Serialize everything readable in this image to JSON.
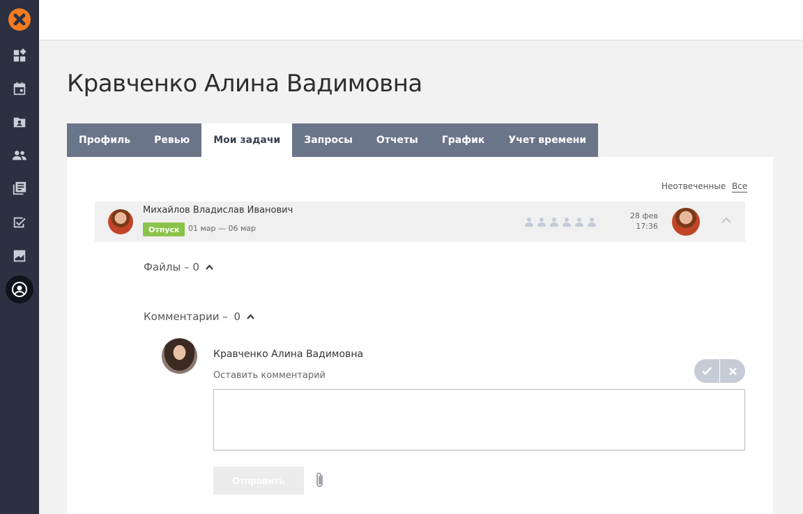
{
  "page": {
    "title": "Кравченко Алина Вадимовна"
  },
  "sidebar": {
    "items": [
      {
        "icon": "dashboard-icon"
      },
      {
        "icon": "calendar-icon"
      },
      {
        "icon": "contacts-folder-icon"
      },
      {
        "icon": "people-icon"
      },
      {
        "icon": "articles-icon"
      },
      {
        "icon": "tasks-check-icon"
      },
      {
        "icon": "analytics-icon"
      },
      {
        "icon": "profile-icon",
        "active": true
      }
    ]
  },
  "tabs": [
    {
      "label": "Профиль"
    },
    {
      "label": "Ревью"
    },
    {
      "label": "Мои задачи",
      "active": true
    },
    {
      "label": "Запросы"
    },
    {
      "label": "Отчеты"
    },
    {
      "label": "График"
    },
    {
      "label": "Учет времени"
    }
  ],
  "filters": {
    "unanswered": "Неотвеченные",
    "all": "Все"
  },
  "task": {
    "author": "Михайлов Владислав Иванович",
    "badge": "Отпуск",
    "period": "01 мар — 06 мар",
    "date": "28 фев",
    "time": "17:36",
    "badge_color": "#8bc34a"
  },
  "files": {
    "label": "Файлы – 0"
  },
  "comments": {
    "label": "Комментарии – ",
    "count": "0",
    "commenter": "Кравченко Алина Вадимовна",
    "leave_label": "Оставить комментарий",
    "input_value": "",
    "send_label": "Отправить"
  },
  "colors": {
    "sidebar": "#2b3140",
    "accent": "#f47b20",
    "tab_bar": "#6b7589"
  }
}
